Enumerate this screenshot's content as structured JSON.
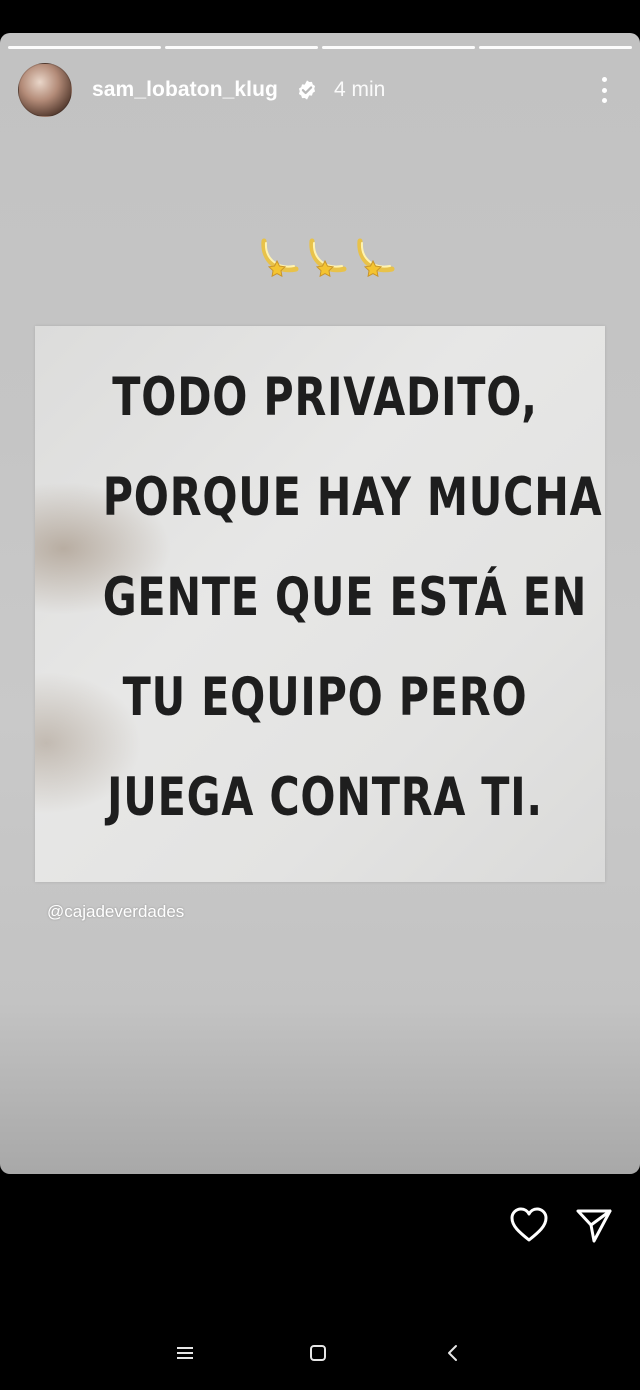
{
  "story": {
    "progress_segments": 4,
    "username": "sam_lobaton_klug",
    "verified": true,
    "time_ago": "4 min",
    "stickers": [
      "dizzy-star",
      "dizzy-star",
      "dizzy-star"
    ],
    "quote_lines": [
      "TODO PRIVADITO,",
      "PORQUE HAY MUCHA",
      "GENTE QUE ESTÁ EN",
      "TU EQUIPO PERO",
      "JUEGA CONTRA TI."
    ],
    "credit": "@cajadeverdades"
  },
  "actions": {
    "like_icon": "heart-icon",
    "share_icon": "send-icon"
  },
  "navbar": {
    "icons": [
      "menu-icon",
      "home-icon",
      "back-icon"
    ]
  },
  "colors": {
    "background": "#000000",
    "story_gray": "#c4c4c4",
    "text_white": "#ffffff",
    "quote_ink": "#1e1e1e"
  }
}
